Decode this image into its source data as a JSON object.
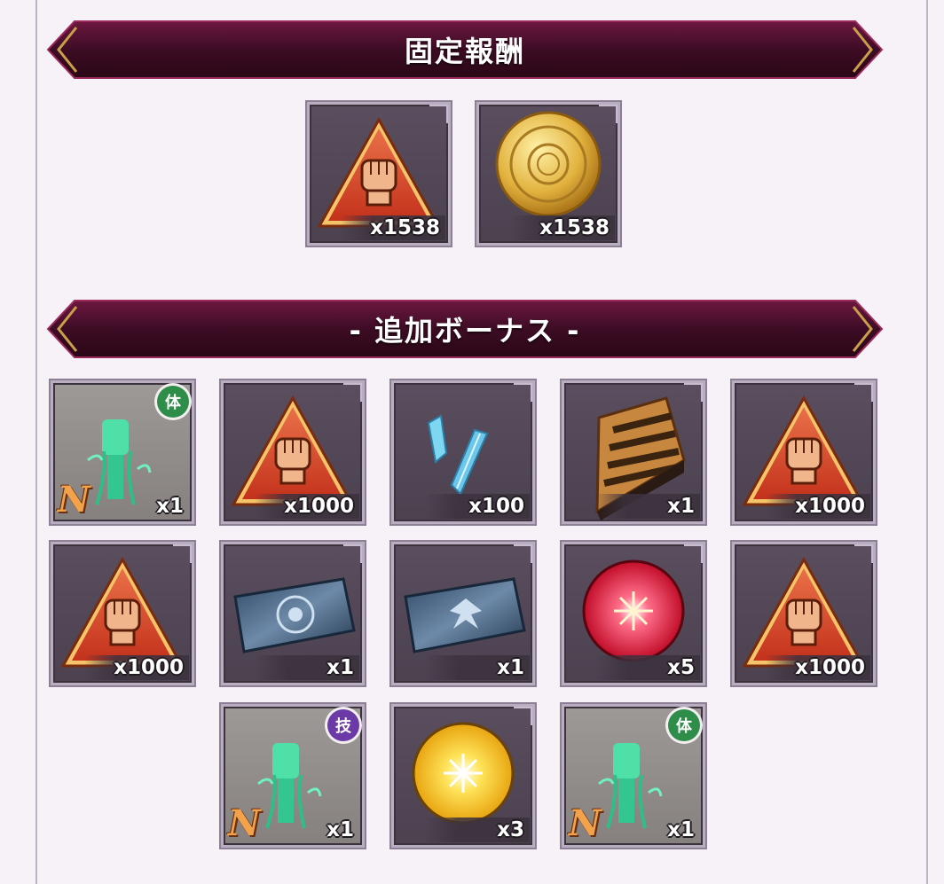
{
  "sections": {
    "fixed_title": "固定報酬",
    "bonus_title": "- 追加ボーナス -"
  },
  "fixed_rewards": [
    {
      "icon": "fist-triangle-token-icon",
      "qty": "x1538"
    },
    {
      "icon": "gold-coin-icon",
      "qty": "x1538"
    }
  ],
  "bonus_rewards": [
    {
      "icon": "green-fist-card-icon",
      "qty": "x1",
      "badge": "体",
      "rarity": "N"
    },
    {
      "icon": "fist-triangle-token-icon",
      "qty": "x1000"
    },
    {
      "icon": "blue-crystal-shards-icon",
      "qty": "x100"
    },
    {
      "icon": "pie-slice-icon",
      "qty": "x1"
    },
    {
      "icon": "fist-triangle-token-icon",
      "qty": "x1000"
    },
    {
      "icon": "fist-triangle-token-icon",
      "qty": "x1000"
    },
    {
      "icon": "blue-ticket-emblem-icon",
      "qty": "x1"
    },
    {
      "icon": "blue-ticket-wings-icon",
      "qty": "x1"
    },
    {
      "icon": "red-orb-icon",
      "qty": "x5"
    },
    {
      "icon": "fist-triangle-token-icon",
      "qty": "x1000"
    },
    {
      "icon": "green-fist-card-icon",
      "qty": "x1",
      "badge": "技",
      "rarity": "N"
    },
    {
      "icon": "gold-orb-icon",
      "qty": "x3"
    },
    {
      "icon": "green-fist-card-icon",
      "qty": "x1",
      "badge": "体",
      "rarity": "N"
    }
  ],
  "colors": {
    "banner_dark": "#2a0a18",
    "banner_mid": "#5a0f33",
    "banner_accent": "#c9a04a",
    "background": "#f7f1f8",
    "badge_green": "#2f8d4a",
    "badge_purple": "#6c3aa6"
  }
}
